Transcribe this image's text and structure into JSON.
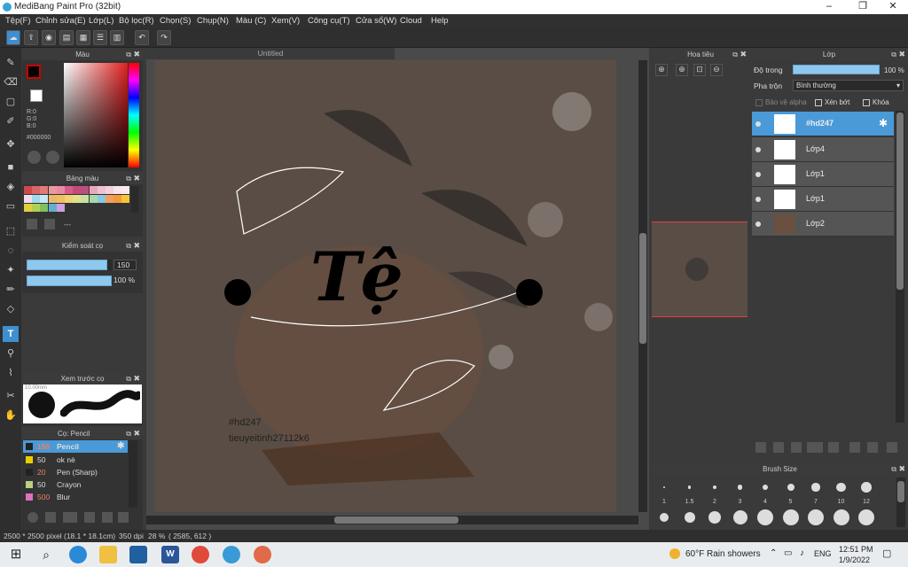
{
  "window": {
    "title": "MediBang Paint Pro (32bit)",
    "minimize": "–",
    "maximize": "❐",
    "close": "✕"
  },
  "menu": [
    "Tệp(F)",
    "Chỉnh sửa(E)",
    "Lớp(L)",
    "Bộ lọc(R)",
    "Chọn(S)",
    "Chụp(N)",
    "Màu (C)",
    "Xem(V)",
    "Công cụ(T)",
    "Cửa sổ(W)",
    "Cloud",
    "Help"
  ],
  "canvas": {
    "tab_title": "Untitled",
    "art_title": "Tệ",
    "watermark_line1": "#hd247",
    "watermark_line2": "tieuyeitinh27112k6"
  },
  "color_panel": {
    "title": "Màu",
    "r": "R:0",
    "g": "G:0",
    "b": "B:0",
    "hex": "#000000"
  },
  "palette_panel": {
    "title": "Bảng màu",
    "dash": "---",
    "swatches": [
      "#c9494e",
      "#d96565",
      "#e07a7a",
      "#e89a9a",
      "#e68aa8",
      "#d75c8a",
      "#c6497a",
      "#b8507f",
      "#e9a6c0",
      "#f0c0d0",
      "#f5d0e0",
      "#f7e4ec",
      "#fbe9f0",
      "#f2dcef",
      "#a0d8ef",
      "#c8e8f5",
      "#e9b86c",
      "#f0c060",
      "#f5d070",
      "#dfe08a",
      "#c8e0a0",
      "#a8d8a8",
      "#88c8e0",
      "#f2a060",
      "#f59a3a",
      "#f5c53a",
      "#e0d040",
      "#b0d050",
      "#80c060",
      "#60b0d0",
      "#d0a0e0"
    ]
  },
  "brush_control": {
    "title": "Kiểm soát cọ",
    "size": "150",
    "opacity": "100 %",
    "size_level": 0.95,
    "opacity_level": 1.0
  },
  "brush_preview": {
    "title": "Xem trước cọ",
    "size_label": "10.00mm"
  },
  "brushes": {
    "title": "Cọ: Pencil",
    "items": [
      {
        "size": "150",
        "name": "Pencil",
        "color": "#222222",
        "selected": true
      },
      {
        "size": "50",
        "name": "ok nè",
        "color": "#e8d000",
        "selected": false
      },
      {
        "size": "20",
        "name": "Pen (Sharp)",
        "color": "#222222",
        "selected": false
      },
      {
        "size": "50",
        "name": "Crayon",
        "color": "#b8d080",
        "selected": false
      },
      {
        "size": "500",
        "name": "Blur",
        "color": "#e070c0",
        "selected": false
      }
    ]
  },
  "navigator": {
    "title": "Hoa tiêu"
  },
  "layers": {
    "title": "Lớp",
    "opacity_label": "Độ trong",
    "opacity_value": "100 %",
    "opacity_level": 1.0,
    "blend_label": "Pha trộn",
    "blend_value": "Bình thường",
    "protect_alpha": "Bảo vệ alpha",
    "clipping": "Xén bớt",
    "lock": "Khóa",
    "items": [
      {
        "name": "#hd247",
        "selected": true
      },
      {
        "name": "Lớp4",
        "selected": false
      },
      {
        "name": "Lớp1",
        "selected": false
      },
      {
        "name": "Lớp1",
        "selected": false
      },
      {
        "name": "Lớp2",
        "selected": false
      }
    ]
  },
  "brush_size": {
    "title": "Brush Size",
    "labels": [
      "1",
      "1.5",
      "2",
      "3",
      "4",
      "5",
      "7",
      "10",
      "12"
    ]
  },
  "status": {
    "dimensions": "2500 * 2500 pixel",
    "physical": "(18.1 * 18.1cm)",
    "dpi": "350 dpi",
    "zoom": "28 %",
    "coords": "( 2585, 612 )"
  },
  "taskbar": {
    "weather": "60°F  Rain showers",
    "lang": "ENG",
    "time": "12:51 PM",
    "date": "1/9/2022"
  },
  "colors": {
    "accent": "#3d8fd1",
    "panel": "#333333",
    "selected_row": "#4a9ad8"
  }
}
